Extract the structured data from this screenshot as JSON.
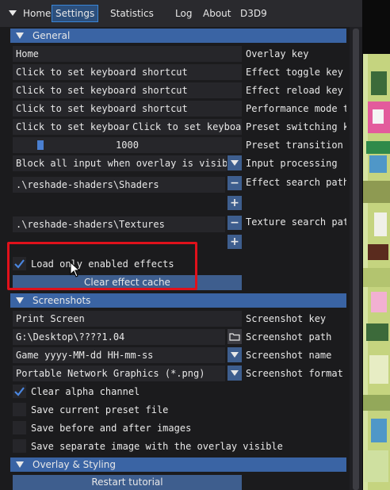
{
  "menu": {
    "items": [
      {
        "label": "Home"
      },
      {
        "label": "Settings",
        "active": true
      },
      {
        "label": "Statistics"
      },
      {
        "label": "Log"
      },
      {
        "label": "About"
      },
      {
        "label": "D3D9"
      }
    ]
  },
  "general": {
    "title": "General",
    "overlay_key_value": "Home",
    "overlay_key_label": "Overlay key",
    "effect_toggle_value": "Click to set keyboard shortcut",
    "effect_toggle_label": "Effect toggle key",
    "effect_reload_value": "Click to set keyboard shortcut",
    "effect_reload_label": "Effect reload key",
    "perf_mode_value": "Click to set keyboard shortcut",
    "perf_mode_label": "Performance mode t",
    "preset_switch_value_a": "Click to set keyboar",
    "preset_switch_value_b": "Click to set keyboar",
    "preset_switch_label": "Preset switching k",
    "preset_transition_value": "1000",
    "preset_transition_fraction": 0.1,
    "preset_transition_label": "Preset transition",
    "input_processing_value": "Block all input when overlay is visibl",
    "input_processing_label": "Input processing",
    "effect_search_path_value": ".\\reshade-shaders\\Shaders",
    "effect_search_path_label": "Effect search path",
    "texture_search_path_value": ".\\reshade-shaders\\Textures",
    "texture_search_path_label": "Texture search pat",
    "minus": "−",
    "plus": "+",
    "load_only_enabled_label": "Load only enabled effects",
    "load_only_enabled_checked": true,
    "clear_cache_label": "Clear effect cache"
  },
  "screenshots": {
    "title": "Screenshots",
    "key_value": "Print Screen",
    "key_label": "Screenshot key",
    "path_value": "G:\\Desktop\\????1.04",
    "path_label": "Screenshot path",
    "name_value": "Game yyyy-MM-dd HH-mm-ss",
    "name_label": "Screenshot name",
    "format_value": "Portable Network Graphics (*.png)",
    "format_label": "Screenshot format",
    "clear_alpha_label": "Clear alpha channel",
    "clear_alpha_checked": true,
    "save_preset_label": "Save current preset file",
    "save_preset_checked": false,
    "save_before_after_label": "Save before and after images",
    "save_before_after_checked": false,
    "save_separate_label": "Save separate image with the overlay visible",
    "save_separate_checked": false
  },
  "overlay": {
    "title": "Overlay & Styling",
    "restart_tutorial_label": "Restart tutorial"
  },
  "colors": {
    "accent": "#3a64a4",
    "button": "#3e5e8e",
    "highlight": "#e0111b"
  }
}
